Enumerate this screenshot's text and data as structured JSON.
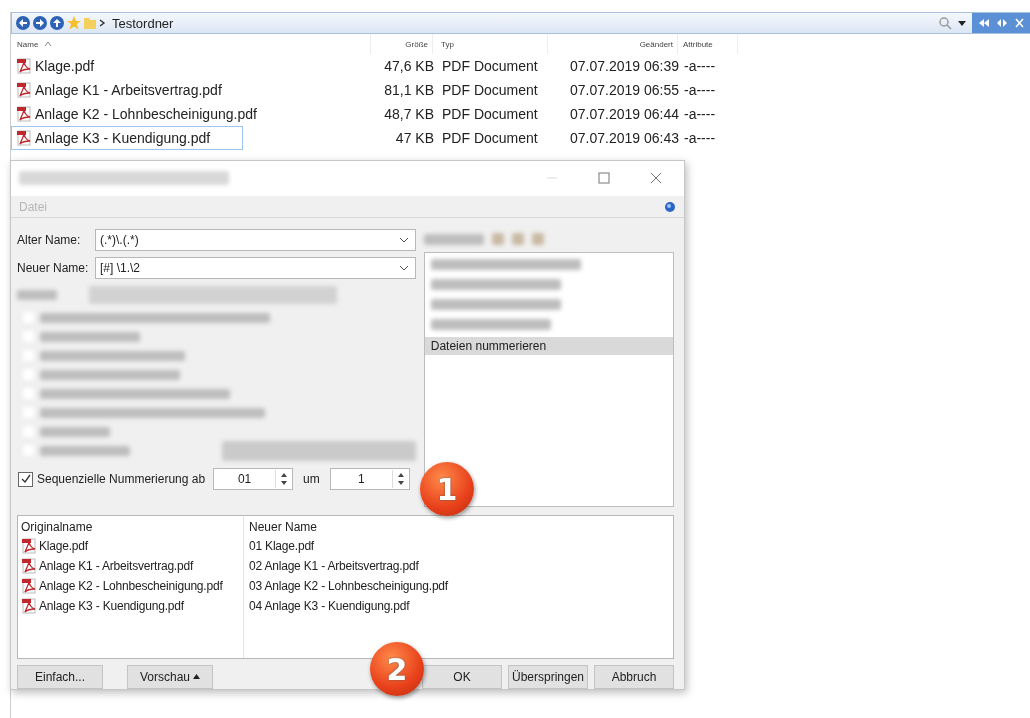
{
  "explorer": {
    "breadcrumb": "Testordner",
    "columns": [
      {
        "kind": "name",
        "label": "Name",
        "sorted": true
      },
      {
        "kind": "size",
        "label": "Größe",
        "sorted": false
      },
      {
        "kind": "type",
        "label": "Typ",
        "sorted": false
      },
      {
        "kind": "modified",
        "label": "Geändert",
        "sorted": false
      },
      {
        "kind": "attributes",
        "label": "Attribute",
        "sorted": false
      }
    ],
    "rows": [
      {
        "name": "Klage.pdf",
        "size": "47,6 KB",
        "type": "PDF Document",
        "modified": "07.07.2019 06:39",
        "attributes": "-a----",
        "selected": false
      },
      {
        "name": "Anlage K1 - Arbeitsvertrag.pdf",
        "size": "81,1 KB",
        "type": "PDF Document",
        "modified": "07.07.2019 06:55",
        "attributes": "-a----",
        "selected": false
      },
      {
        "name": "Anlage K2 - Lohnbescheinigung.pdf",
        "size": "48,7 KB",
        "type": "PDF Document",
        "modified": "07.07.2019 06:44",
        "attributes": "-a----",
        "selected": false
      },
      {
        "name": "Anlage K3 - Kuendigung.pdf",
        "size": "47 KB",
        "type": "PDF Document",
        "modified": "07.07.2019 06:43",
        "attributes": "-a----",
        "selected": true
      }
    ]
  },
  "dialog": {
    "menu": [
      "Datei"
    ],
    "old_name": {
      "label": "Alter Name:",
      "value": "(.*)\\.(.*)"
    },
    "new_name": {
      "label": "Neuer Name:",
      "value": "[#] \\1.\\2"
    },
    "blurred_options": [
      {
        "checked": false
      },
      {
        "checked": false
      },
      {
        "checked": false
      },
      {
        "checked": false
      },
      {
        "checked": false
      },
      {
        "checked": false
      },
      {
        "checked": false
      },
      {
        "checked": false
      }
    ],
    "presets": [
      {
        "label": "Dateien nummerieren",
        "selected": true
      }
    ],
    "numbering": {
      "checked": true,
      "label": "Sequenzielle Nummerierung ab",
      "start": "01",
      "step_label": "um",
      "step": "1"
    },
    "preview": {
      "columns": [
        "Originalname",
        "Neuer Name"
      ],
      "rows": [
        {
          "original": "Klage.pdf",
          "renamed": "01  Klage.pdf"
        },
        {
          "original": "Anlage K1 - Arbeitsvertrag.pdf",
          "renamed": "02 Anlage K1 - Arbeitsvertrag.pdf"
        },
        {
          "original": "Anlage K2 - Lohnbescheinigung.pdf",
          "renamed": "03 Anlage K2 - Lohnbescheinigung.pdf"
        },
        {
          "original": "Anlage K3 - Kuendigung.pdf",
          "renamed": "04 Anlage K3 - Kuendigung.pdf"
        }
      ]
    },
    "buttons": [
      {
        "label": "Einfach...",
        "kind": "left"
      },
      {
        "label": "Vorschau",
        "kind": "menu"
      },
      {
        "label": "OK",
        "kind": "right"
      },
      {
        "label": "Überspringen",
        "kind": "right"
      },
      {
        "label": "Abbruch",
        "kind": "right"
      }
    ]
  },
  "callouts": [
    {
      "label": "1"
    },
    {
      "label": "2"
    }
  ]
}
